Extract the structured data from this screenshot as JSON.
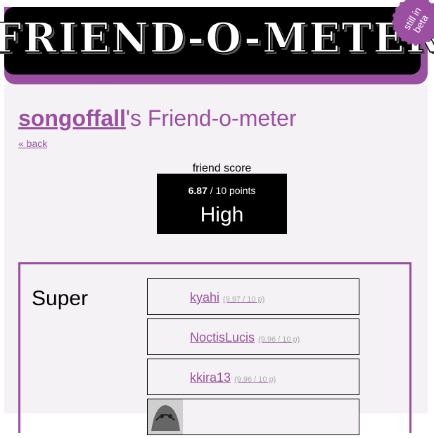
{
  "header": {
    "logo_text": "FRIEND-O-METER",
    "beta_badge": "still in beta"
  },
  "profile": {
    "username": "songoffall",
    "title_suffix": "'s Friend-o-meter",
    "back_label": "« back"
  },
  "score": {
    "label": "friend score",
    "value": "6.87",
    "max_text": " / 10 points",
    "level": "High"
  },
  "groups": [
    {
      "name": "Super",
      "friends": [
        {
          "name": "kyahi",
          "score": "(9.97 / 10 p)"
        },
        {
          "name": "NoctisLucis",
          "score": "(9.96 / 10 p)"
        },
        {
          "name": "kkira13",
          "score": "(9.96 / 10 p)"
        },
        {
          "name": "",
          "score": ""
        }
      ]
    }
  ],
  "colors": {
    "accent": "#9a4fa1",
    "background": "#f4f2f4",
    "header": "#000000"
  }
}
